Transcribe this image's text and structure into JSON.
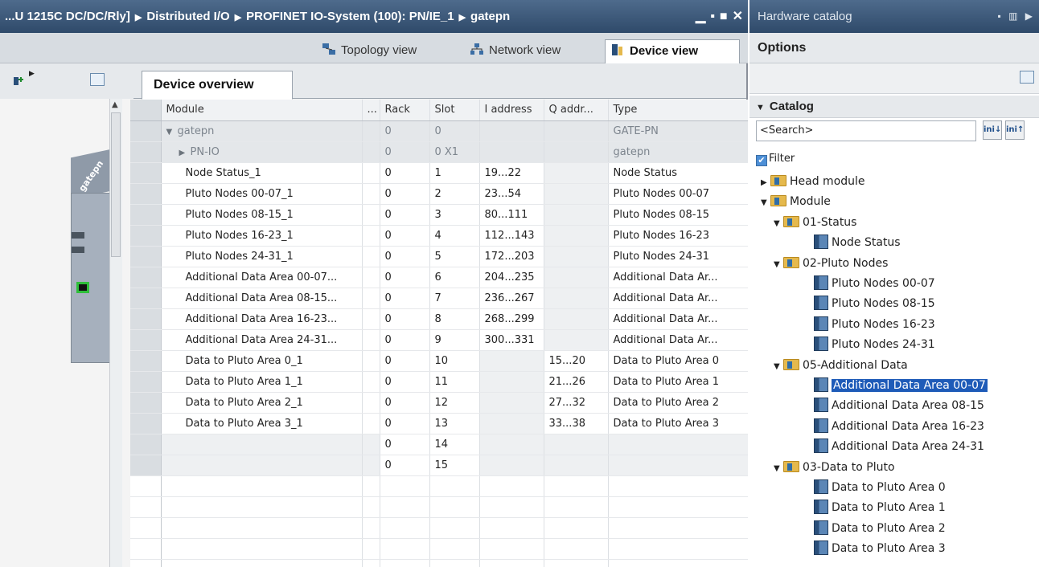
{
  "editor": {
    "title_parts": [
      "...U 1215C DC/DC/Rly]",
      "Distributed I/O",
      "PROFINET IO-System (100): PN/IE_1",
      "gatepn"
    ],
    "view_tabs": [
      {
        "label": "Topology view",
        "icon": "topology-icon"
      },
      {
        "label": "Network view",
        "icon": "network-icon"
      },
      {
        "label": "Device view",
        "icon": "device-icon",
        "active": true
      }
    ],
    "device_label": "gatepn",
    "overview_tab": "Device overview"
  },
  "table": {
    "columns": [
      "Module",
      "...",
      "Rack",
      "Slot",
      "I address",
      "Q addr...",
      "Type"
    ],
    "rows": [
      {
        "module": "gatepn",
        "rack": "0",
        "slot": "0",
        "i": "",
        "q": "",
        "type": "GATE-PN",
        "caret": "▼",
        "indent": 1,
        "greyed": true
      },
      {
        "module": "PN-IO",
        "rack": "0",
        "slot": "0 X1",
        "i": "",
        "q": "",
        "type": "gatepn",
        "caret": "▶",
        "indent": 2,
        "greyed": true
      },
      {
        "module": "Node Status_1",
        "rack": "0",
        "slot": "1",
        "i": "19...22",
        "q": "",
        "type": "Node Status"
      },
      {
        "module": "Pluto Nodes 00-07_1",
        "rack": "0",
        "slot": "2",
        "i": "23...54",
        "q": "",
        "type": "Pluto Nodes 00-07"
      },
      {
        "module": "Pluto Nodes 08-15_1",
        "rack": "0",
        "slot": "3",
        "i": "80...111",
        "q": "",
        "type": "Pluto Nodes 08-15"
      },
      {
        "module": "Pluto Nodes 16-23_1",
        "rack": "0",
        "slot": "4",
        "i": "112...143",
        "q": "",
        "type": "Pluto Nodes 16-23"
      },
      {
        "module": "Pluto Nodes 24-31_1",
        "rack": "0",
        "slot": "5",
        "i": "172...203",
        "q": "",
        "type": "Pluto Nodes 24-31"
      },
      {
        "module": "Additional Data Area 00-07...",
        "rack": "0",
        "slot": "6",
        "i": "204...235",
        "q": "",
        "type": "Additional Data Ar..."
      },
      {
        "module": "Additional Data Area 08-15...",
        "rack": "0",
        "slot": "7",
        "i": "236...267",
        "q": "",
        "type": "Additional Data Ar..."
      },
      {
        "module": "Additional Data Area 16-23...",
        "rack": "0",
        "slot": "8",
        "i": "268...299",
        "q": "",
        "type": "Additional Data Ar..."
      },
      {
        "module": "Additional Data Area 24-31...",
        "rack": "0",
        "slot": "9",
        "i": "300...331",
        "q": "",
        "type": "Additional Data Ar..."
      },
      {
        "module": "Data to Pluto Area 0_1",
        "rack": "0",
        "slot": "10",
        "i": "",
        "q": "15...20",
        "type": "Data to Pluto Area 0"
      },
      {
        "module": "Data to Pluto Area 1_1",
        "rack": "0",
        "slot": "11",
        "i": "",
        "q": "21...26",
        "type": "Data to Pluto Area 1"
      },
      {
        "module": "Data to Pluto Area 2_1",
        "rack": "0",
        "slot": "12",
        "i": "",
        "q": "27...32",
        "type": "Data to Pluto Area 2"
      },
      {
        "module": "Data to Pluto Area 3_1",
        "rack": "0",
        "slot": "13",
        "i": "",
        "q": "33...38",
        "type": "Data to Pluto Area 3"
      },
      {
        "module": "",
        "rack": "0",
        "slot": "14",
        "i": "",
        "q": "",
        "type": "",
        "slot_only": true
      },
      {
        "module": "",
        "rack": "0",
        "slot": "15",
        "i": "",
        "q": "",
        "type": "",
        "slot_only": true
      }
    ],
    "empty_rows": 5
  },
  "catalog": {
    "title": "Hardware catalog",
    "options_label": "Options",
    "header": "Catalog",
    "search_placeholder": "<Search>",
    "filter_label": "Filter",
    "filter_checked": true,
    "tree": [
      {
        "label": "Head module",
        "level": 0,
        "type": "folder",
        "toggle": "▶"
      },
      {
        "label": "Module",
        "level": 0,
        "type": "folder",
        "toggle": "▼"
      },
      {
        "label": "01-Status",
        "level": 1,
        "type": "folder",
        "toggle": "▼"
      },
      {
        "label": "Node Status",
        "level": 2,
        "type": "module"
      },
      {
        "label": "02-Pluto Nodes",
        "level": 1,
        "type": "folder",
        "toggle": "▼"
      },
      {
        "label": "Pluto Nodes 00-07",
        "level": 2,
        "type": "module"
      },
      {
        "label": "Pluto Nodes 08-15",
        "level": 2,
        "type": "module"
      },
      {
        "label": "Pluto Nodes 16-23",
        "level": 2,
        "type": "module"
      },
      {
        "label": "Pluto Nodes 24-31",
        "level": 2,
        "type": "module"
      },
      {
        "label": "05-Additional Data",
        "level": 1,
        "type": "folder",
        "toggle": "▼"
      },
      {
        "label": "Additional Data Area 00-07",
        "level": 2,
        "type": "module",
        "selected": true
      },
      {
        "label": "Additional Data Area 08-15",
        "level": 2,
        "type": "module"
      },
      {
        "label": "Additional Data Area 16-23",
        "level": 2,
        "type": "module"
      },
      {
        "label": "Additional Data Area 24-31",
        "level": 2,
        "type": "module"
      },
      {
        "label": "03-Data to Pluto",
        "level": 1,
        "type": "folder",
        "toggle": "▼"
      },
      {
        "label": "Data to Pluto Area 0",
        "level": 2,
        "type": "module"
      },
      {
        "label": "Data to Pluto Area 1",
        "level": 2,
        "type": "module"
      },
      {
        "label": "Data to Pluto Area 2",
        "level": 2,
        "type": "module"
      },
      {
        "label": "Data to Pluto Area 3",
        "level": 2,
        "type": "module"
      }
    ]
  }
}
